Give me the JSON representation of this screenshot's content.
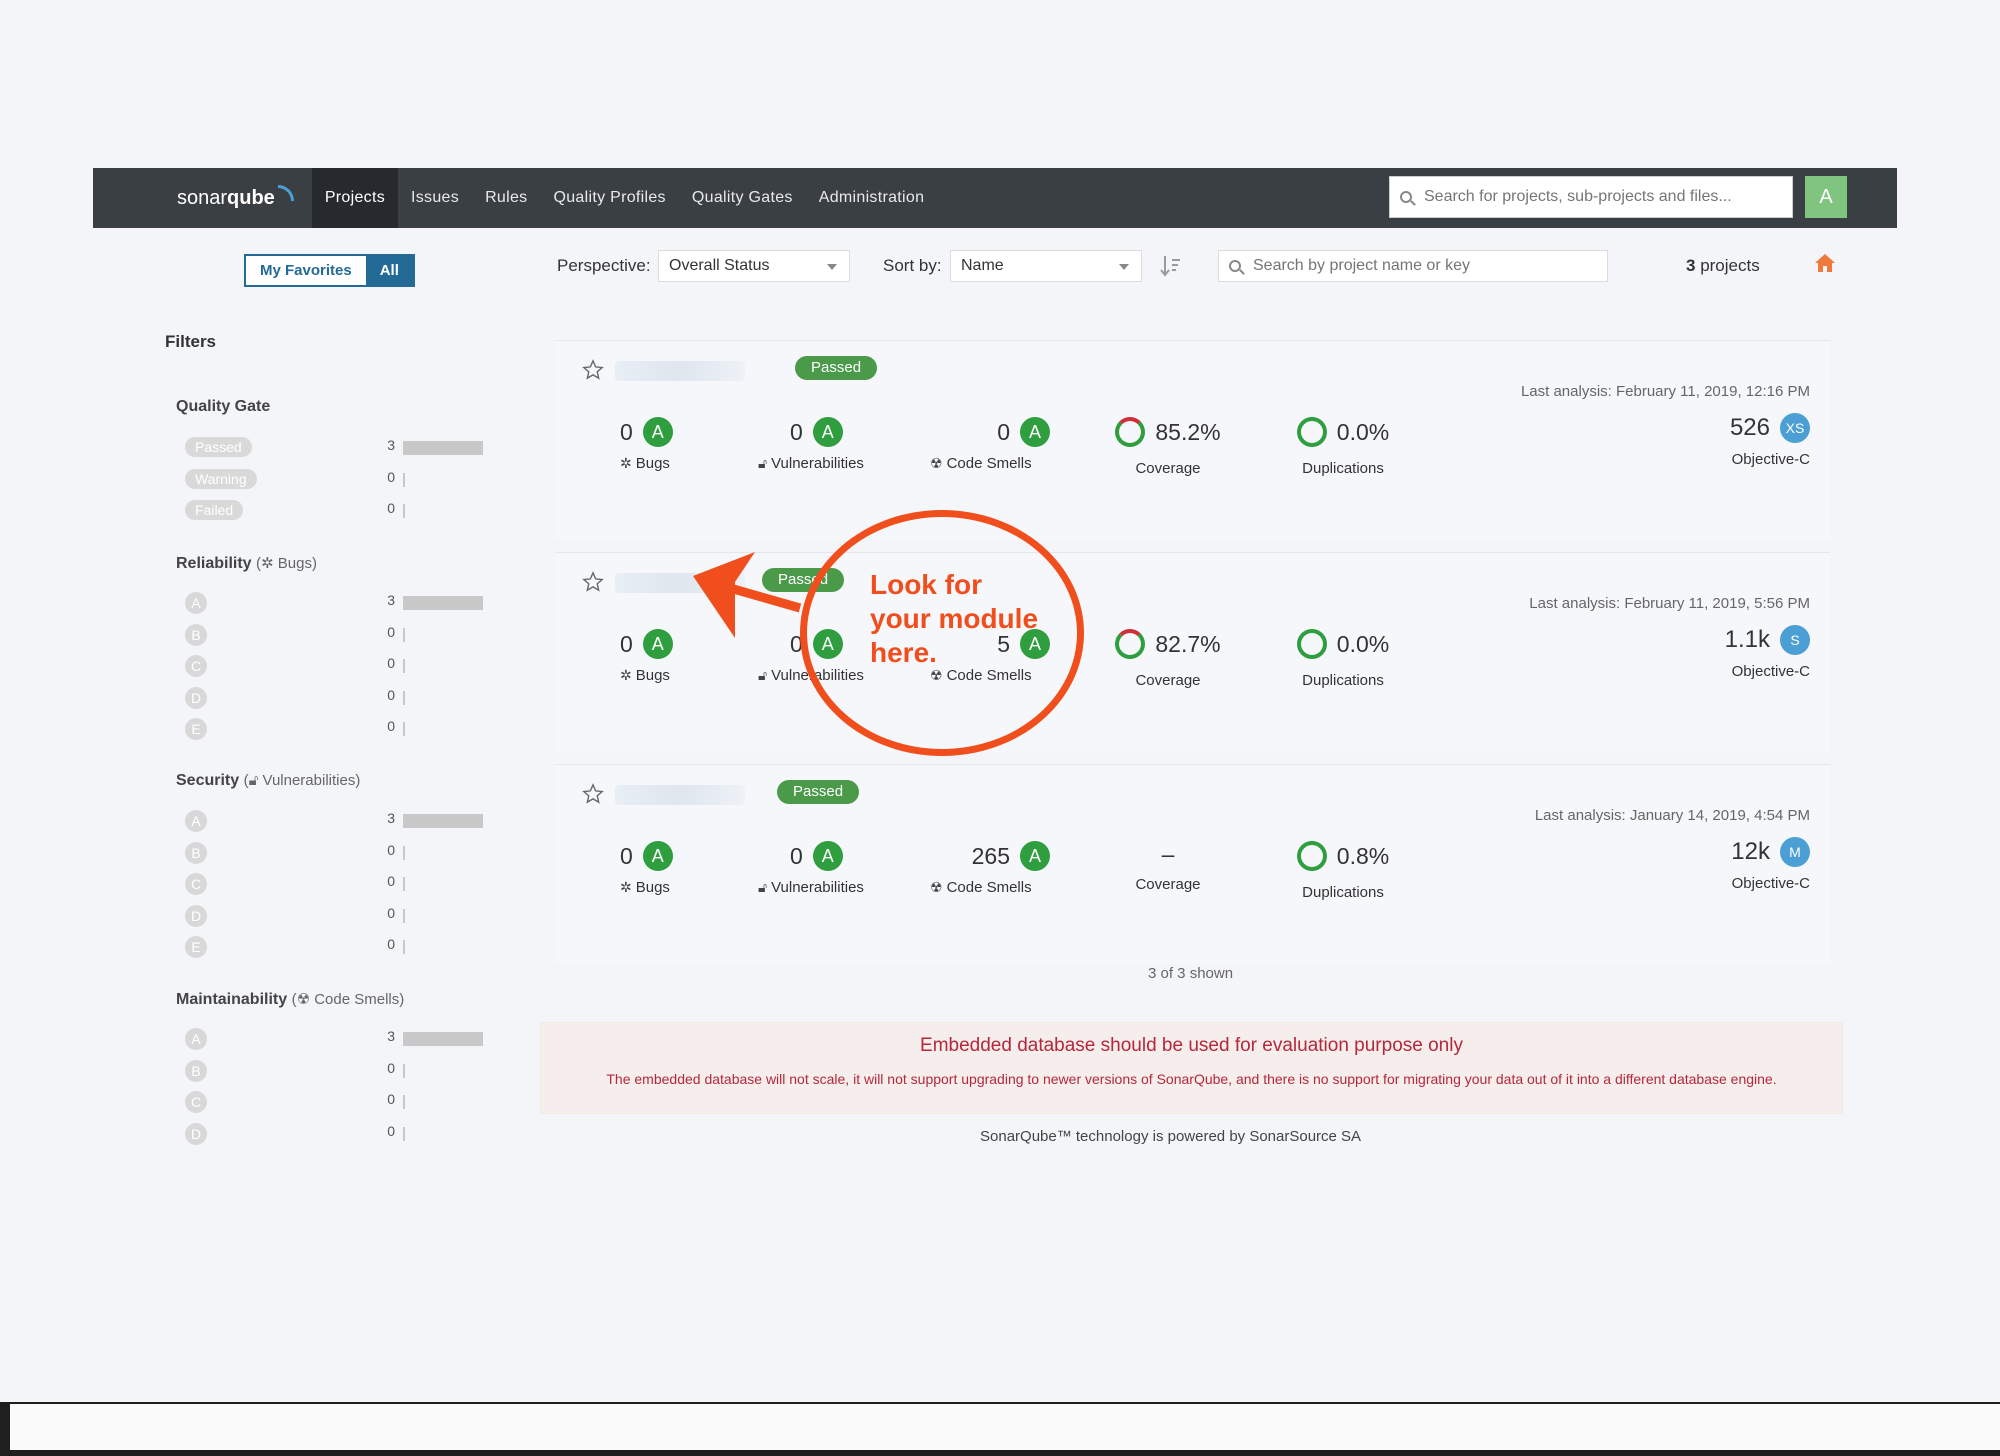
{
  "nav": {
    "logo_text_1": "sonar",
    "logo_text_2": "qube",
    "items": [
      "Projects",
      "Issues",
      "Rules",
      "Quality Profiles",
      "Quality Gates",
      "Administration"
    ],
    "help_label": "?",
    "search_placeholder": "Search for projects, sub-projects and files...",
    "user_initial": "A"
  },
  "controls": {
    "my_favorites": "My Favorites",
    "all": "All",
    "perspective_label": "Perspective:",
    "perspective_value": "Overall Status",
    "sort_label": "Sort by:",
    "sort_value": "Name",
    "project_search_placeholder": "Search by project name or key",
    "project_count": "3",
    "project_count_suffix": " projects"
  },
  "filters": {
    "title": "Filters",
    "quality_gate": {
      "title": "Quality Gate",
      "rows": [
        {
          "label": "Passed",
          "count": "3",
          "fraction": 1.0
        },
        {
          "label": "Warning",
          "count": "0",
          "fraction": 0
        },
        {
          "label": "Failed",
          "count": "0",
          "fraction": 0
        }
      ]
    },
    "reliability": {
      "title": "Reliability",
      "subtitle": "Bugs",
      "rows": [
        {
          "label": "A",
          "count": "3",
          "fraction": 1.0
        },
        {
          "label": "B",
          "count": "0",
          "fraction": 0
        },
        {
          "label": "C",
          "count": "0",
          "fraction": 0
        },
        {
          "label": "D",
          "count": "0",
          "fraction": 0
        },
        {
          "label": "E",
          "count": "0",
          "fraction": 0
        }
      ]
    },
    "security": {
      "title": "Security",
      "subtitle": "Vulnerabilities",
      "rows": [
        {
          "label": "A",
          "count": "3",
          "fraction": 1.0
        },
        {
          "label": "B",
          "count": "0",
          "fraction": 0
        },
        {
          "label": "C",
          "count": "0",
          "fraction": 0
        },
        {
          "label": "D",
          "count": "0",
          "fraction": 0
        },
        {
          "label": "E",
          "count": "0",
          "fraction": 0
        }
      ]
    },
    "maintainability": {
      "title": "Maintainability",
      "subtitle": "Code Smells",
      "rows": [
        {
          "label": "A",
          "count": "3",
          "fraction": 1.0
        },
        {
          "label": "B",
          "count": "0",
          "fraction": 0
        },
        {
          "label": "C",
          "count": "0",
          "fraction": 0
        },
        {
          "label": "D",
          "count": "0",
          "fraction": 0
        }
      ]
    }
  },
  "projects": [
    {
      "gate": "Passed",
      "last_analysis": "Last analysis: February 11, 2019, 12:16 PM",
      "bugs": "0",
      "bugs_grade": "A",
      "vulns": "0",
      "vulns_grade": "A",
      "smells": "0",
      "smells_grade": "A",
      "coverage": "85.2%",
      "duplications": "0.0%",
      "size": "526",
      "size_badge": "XS",
      "language": "Objective-C"
    },
    {
      "gate": "Passed",
      "last_analysis": "Last analysis: February 11, 2019, 5:56 PM",
      "bugs": "0",
      "bugs_grade": "A",
      "vulns": "0",
      "vulns_grade": "A",
      "smells": "5",
      "smells_grade": "A",
      "coverage": "82.7%",
      "duplications": "0.0%",
      "size": "1.1k",
      "size_badge": "S",
      "language": "Objective-C"
    },
    {
      "gate": "Passed",
      "last_analysis": "Last analysis: January 14, 2019, 4:54 PM",
      "bugs": "0",
      "bugs_grade": "A",
      "vulns": "0",
      "vulns_grade": "A",
      "smells": "265",
      "smells_grade": "A",
      "coverage": "–",
      "duplications": "0.8%",
      "size": "12k",
      "size_badge": "M",
      "language": "Objective-C"
    }
  ],
  "labels": {
    "bugs": "Bugs",
    "vulnerabilities": "Vulnerabilities",
    "code_smells": "Code Smells",
    "coverage": "Coverage",
    "duplications": "Duplications"
  },
  "shown": "3 of 3 shown",
  "warning": {
    "title": "Embedded database should be used for evaluation purpose only",
    "text": "The embedded database will not scale, it will not support upgrading to newer versions of SonarQube, and there is no support for migrating your data out of it into a different database engine."
  },
  "footer": "SonarQube™ technology is powered by SonarSource SA",
  "annotation": {
    "line1": "Look for",
    "line2": "your module",
    "line3": "here.",
    "color": "#f04e1c"
  }
}
